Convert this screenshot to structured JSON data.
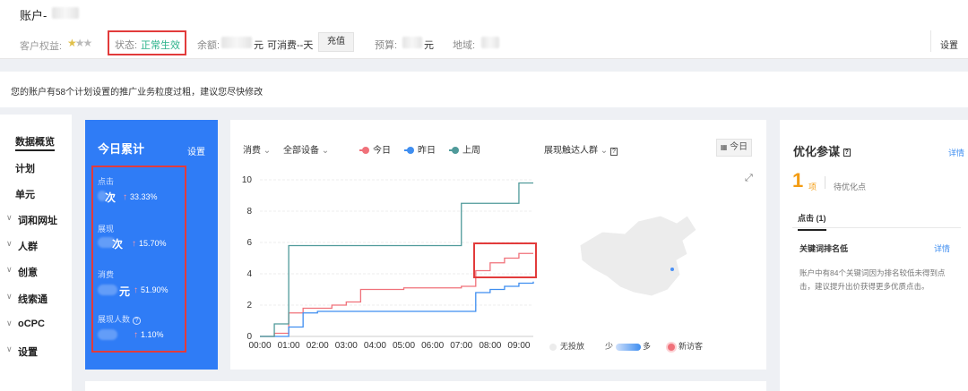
{
  "topbar": {
    "account_label": "账户-",
    "rights_label": "客户权益:",
    "status_label": "状态:",
    "status_value": "正常生效",
    "balance_label": "余额:",
    "balance_unit": "元",
    "consume_text": "可消费--天",
    "recharge_button": "充值",
    "budget_label": "预算:",
    "budget_unit": "元",
    "region_label": "地域:",
    "settings_link": "设置"
  },
  "notice": {
    "text": "您的账户有58个计划设置的推广业务粒度过粗，建议您尽快修改"
  },
  "sidebar": {
    "items": [
      {
        "label": "数据概览",
        "expandable": false,
        "active": true
      },
      {
        "label": "计划",
        "expandable": false,
        "active": false
      },
      {
        "label": "单元",
        "expandable": false,
        "active": false
      },
      {
        "label": "词和网址",
        "expandable": true,
        "active": false
      },
      {
        "label": "人群",
        "expandable": true,
        "active": false
      },
      {
        "label": "创意",
        "expandable": true,
        "active": false
      },
      {
        "label": "线索通",
        "expandable": true,
        "active": false
      },
      {
        "label": "oCPC",
        "expandable": true,
        "active": false
      },
      {
        "label": "设置",
        "expandable": true,
        "active": false
      }
    ]
  },
  "today": {
    "title": "今日累计",
    "settings": "设置",
    "metrics": [
      {
        "label": "点击",
        "unit": "次",
        "change": "33.33%"
      },
      {
        "label": "展现",
        "unit": "次",
        "change": "15.70%"
      },
      {
        "label": "消费",
        "unit": "元",
        "change": "51.90%"
      },
      {
        "label": "展现人数",
        "unit": "",
        "change": "1.10%"
      }
    ]
  },
  "chart_panel": {
    "metric_select": "消费",
    "device_select": "全部设备",
    "legend": [
      {
        "name": "今日",
        "color": "#f0717a"
      },
      {
        "name": "昨日",
        "color": "#3f8ef0"
      },
      {
        "name": "上周",
        "color": "#4f9a9a"
      }
    ],
    "audience_select": "展现触达人群",
    "date_button": "今日",
    "map_legend": {
      "none": "无投放",
      "less": "少",
      "more": "多",
      "new_visitor": "新访客"
    }
  },
  "chart_data": {
    "type": "line",
    "x": [
      "00:00",
      "00:30",
      "01:00",
      "01:30",
      "02:00",
      "02:30",
      "03:00",
      "03:30",
      "04:00",
      "04:30",
      "05:00",
      "05:30",
      "06:00",
      "06:30",
      "07:00",
      "07:30",
      "08:00",
      "08:30",
      "09:00",
      "09:30"
    ],
    "xticks": [
      "00:00",
      "01:00",
      "02:00",
      "03:00",
      "04:00",
      "05:00",
      "06:00",
      "07:00",
      "08:00",
      "09:00"
    ],
    "yticks": [
      "0",
      "2",
      "4",
      "6",
      "8",
      "10"
    ],
    "ylim": [
      0,
      10
    ],
    "series": [
      {
        "name": "今日",
        "color": "#f0717a",
        "values": [
          0,
          0.2,
          1.5,
          1.8,
          1.8,
          2.0,
          2.2,
          3.0,
          3.0,
          3.0,
          3.1,
          3.1,
          3.1,
          3.1,
          3.2,
          4.2,
          4.7,
          5.0,
          5.3,
          5.3
        ]
      },
      {
        "name": "昨日",
        "color": "#3f8ef0",
        "values": [
          0,
          0,
          0.6,
          1.5,
          1.6,
          1.6,
          1.6,
          1.6,
          1.6,
          1.6,
          1.6,
          1.6,
          1.6,
          1.6,
          1.6,
          2.8,
          3.0,
          3.2,
          3.4,
          3.5
        ]
      },
      {
        "name": "上周",
        "color": "#4f9a9a",
        "values": [
          0,
          0.8,
          5.8,
          5.8,
          5.8,
          5.8,
          5.8,
          5.8,
          5.8,
          5.8,
          5.8,
          5.8,
          5.8,
          5.8,
          8.5,
          8.5,
          8.5,
          8.5,
          9.8,
          9.8
        ]
      }
    ]
  },
  "right_panel": {
    "title": "优化参谋",
    "detail_link": "详情",
    "count": "1",
    "count_unit": "项",
    "count_desc": "待优化点",
    "tab": "点击 (1)",
    "item_title": "关键词排名低",
    "item_link": "详情",
    "item_desc": "账户中有84个关键词因为排名较低未得到点击，建议提升出价获得更多优质点击。"
  }
}
